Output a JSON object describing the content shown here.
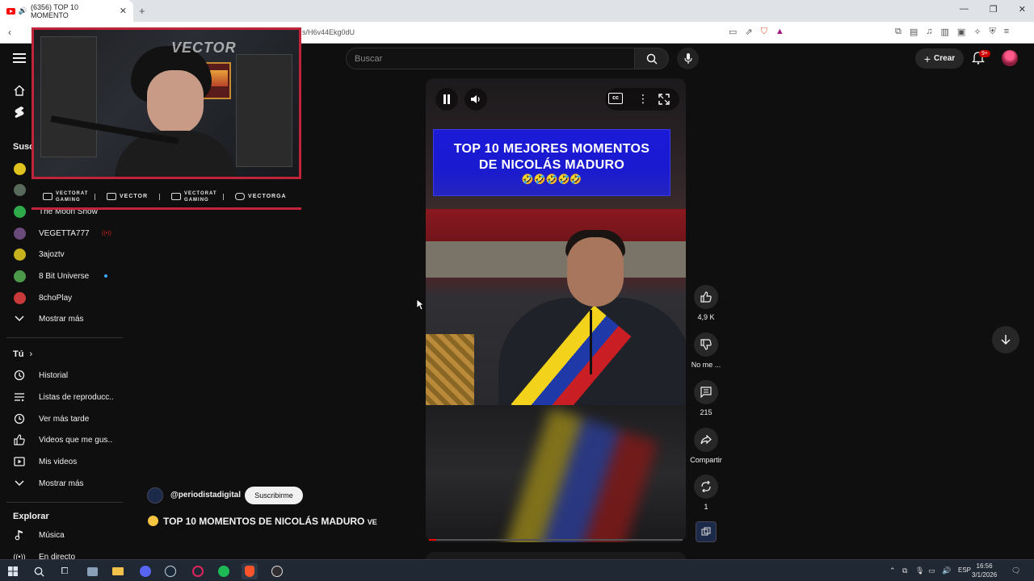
{
  "browser": {
    "tab_title": "(6356) TOP 10 MOMENTO",
    "url": "s/H6v44Ekg0dU",
    "new_tab": "+",
    "close": "✕",
    "win_min": "—",
    "win_max": "❐",
    "win_close": "✕"
  },
  "header": {
    "search_placeholder": "Buscar",
    "create_label": "Crear",
    "notif_count": "9+"
  },
  "sidebar": {
    "subs_heading": "Susc",
    "channels": [
      {
        "name": "The Moon Show",
        "color": "#2faa4a"
      },
      {
        "name": "VEGETTA777",
        "color": "#6a4a7a"
      },
      {
        "name": "3ajoztv",
        "color": "#c8b11e"
      },
      {
        "name": "8 Bit Universe",
        "color": "#4a9a4a"
      },
      {
        "name": "8choPlay",
        "color": "#c83a3a"
      }
    ],
    "show_more_1": "Mostrar más",
    "you_heading": "Tú",
    "you_items": [
      {
        "label": "Historial",
        "icon": "history-icon"
      },
      {
        "label": "Listas de reproducc...",
        "icon": "playlists-icon"
      },
      {
        "label": "Ver más tarde",
        "icon": "watch-later-icon"
      },
      {
        "label": "Videos que me gus...",
        "icon": "liked-videos-icon"
      },
      {
        "label": "Mis videos",
        "icon": "my-videos-icon"
      }
    ],
    "show_more_2": "Mostrar más",
    "explore_heading": "Explorar",
    "explore_items": [
      {
        "label": "Música",
        "icon": "music-icon"
      },
      {
        "label": "En directo",
        "icon": "live-icon"
      }
    ]
  },
  "overlay": {
    "watermark": "VECTOR",
    "socials": [
      {
        "label": "VECTORAT GAMING",
        "icon": "youtube-icon"
      },
      {
        "label": "VECTOR",
        "icon": "twitch-icon"
      },
      {
        "label": "VECTORAT GAMING",
        "icon": "twitter-icon"
      },
      {
        "label": "VECTORGA",
        "icon": "instagram-icon"
      }
    ]
  },
  "player": {
    "card_line1": "TOP 10  MEJORES MOMENTOS",
    "card_line2": "DE NICOLÁS MADURO",
    "card_emojis": "🤣🤣🤣🤣🤣",
    "progress": 0.03
  },
  "actions": {
    "likes": "4,9 K",
    "dislike": "No me ...",
    "comments": "215",
    "share": "Compartir",
    "remix": "1"
  },
  "video": {
    "channel": "@periodistadigital",
    "subscribe": "Suscribirme",
    "title": "TOP 10 MOMENTOS DE NICOLÁS MADURO",
    "title_tail": "VE"
  },
  "taskbar": {
    "lang": "ESP",
    "time": "16:56",
    "date": "3/1/2026"
  },
  "colors": {
    "brand_red": "#ff0000",
    "overlay_red": "#c0243a",
    "card_blue": "#1b1bd8"
  }
}
